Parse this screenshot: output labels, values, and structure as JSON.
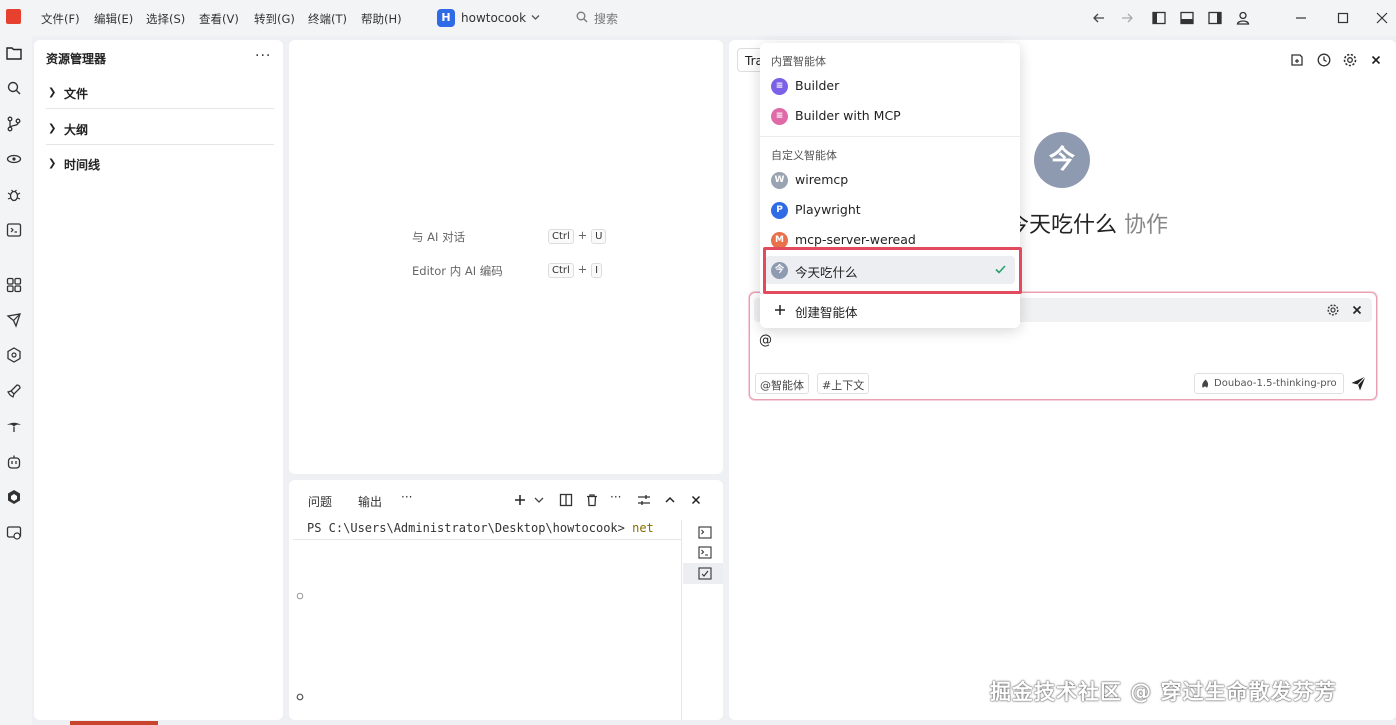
{
  "titlebar": {
    "menus": [
      "文件(F)",
      "编辑(E)",
      "选择(S)",
      "查看(V)",
      "转到(G)",
      "终端(T)",
      "帮助(H)"
    ],
    "project_initial": "H",
    "project_name": "howtocook",
    "search_placeholder": "搜索"
  },
  "explorer": {
    "title": "资源管理器",
    "more": "···",
    "sections": [
      "文件",
      "大纲",
      "时间线"
    ]
  },
  "editor": {
    "hints": [
      {
        "label": "与 AI 对话",
        "keys": [
          "Ctrl",
          "U"
        ]
      },
      {
        "label": "Editor 内 AI 编码",
        "keys": [
          "Ctrl",
          "I"
        ]
      }
    ],
    "key_sep": "+"
  },
  "terminal": {
    "tabs": [
      "问题",
      "输出",
      "···"
    ],
    "prompt": "PS C:\\Users\\Administrator\\Desktop\\howtocook> ",
    "command": "net"
  },
  "chat": {
    "partial_tab": "Tra",
    "bot_initial": "今",
    "bot_name": "今天吃什么",
    "bot_suffix": "协作",
    "input_value": "@",
    "chip_agent": "@智能体",
    "chip_context": "#上下文",
    "model": "Doubao-1.5-thinking-pro"
  },
  "dropdown": {
    "builtin_header": "内置智能体",
    "builtin": [
      {
        "name": "Builder",
        "color": "#7b61e8",
        "initial": "≡"
      },
      {
        "name": "Builder with MCP",
        "color": "#e06aa8",
        "initial": "≡"
      }
    ],
    "custom_header": "自定义智能体",
    "custom": [
      {
        "name": "wiremcp",
        "color": "#9aa3b2",
        "initial": "W"
      },
      {
        "name": "Playwright",
        "color": "#2f6be6",
        "initial": "P"
      },
      {
        "name": "mcp-server-weread",
        "color": "#e8704a",
        "initial": "M"
      },
      {
        "name": "今天吃什么",
        "color": "#8e9aaf",
        "initial": "今",
        "selected": true
      }
    ],
    "create_label": "创建智能体",
    "check_color": "#2aa06b"
  },
  "watermark": "掘金技术社区 @ 穿过生命散发芬芳"
}
